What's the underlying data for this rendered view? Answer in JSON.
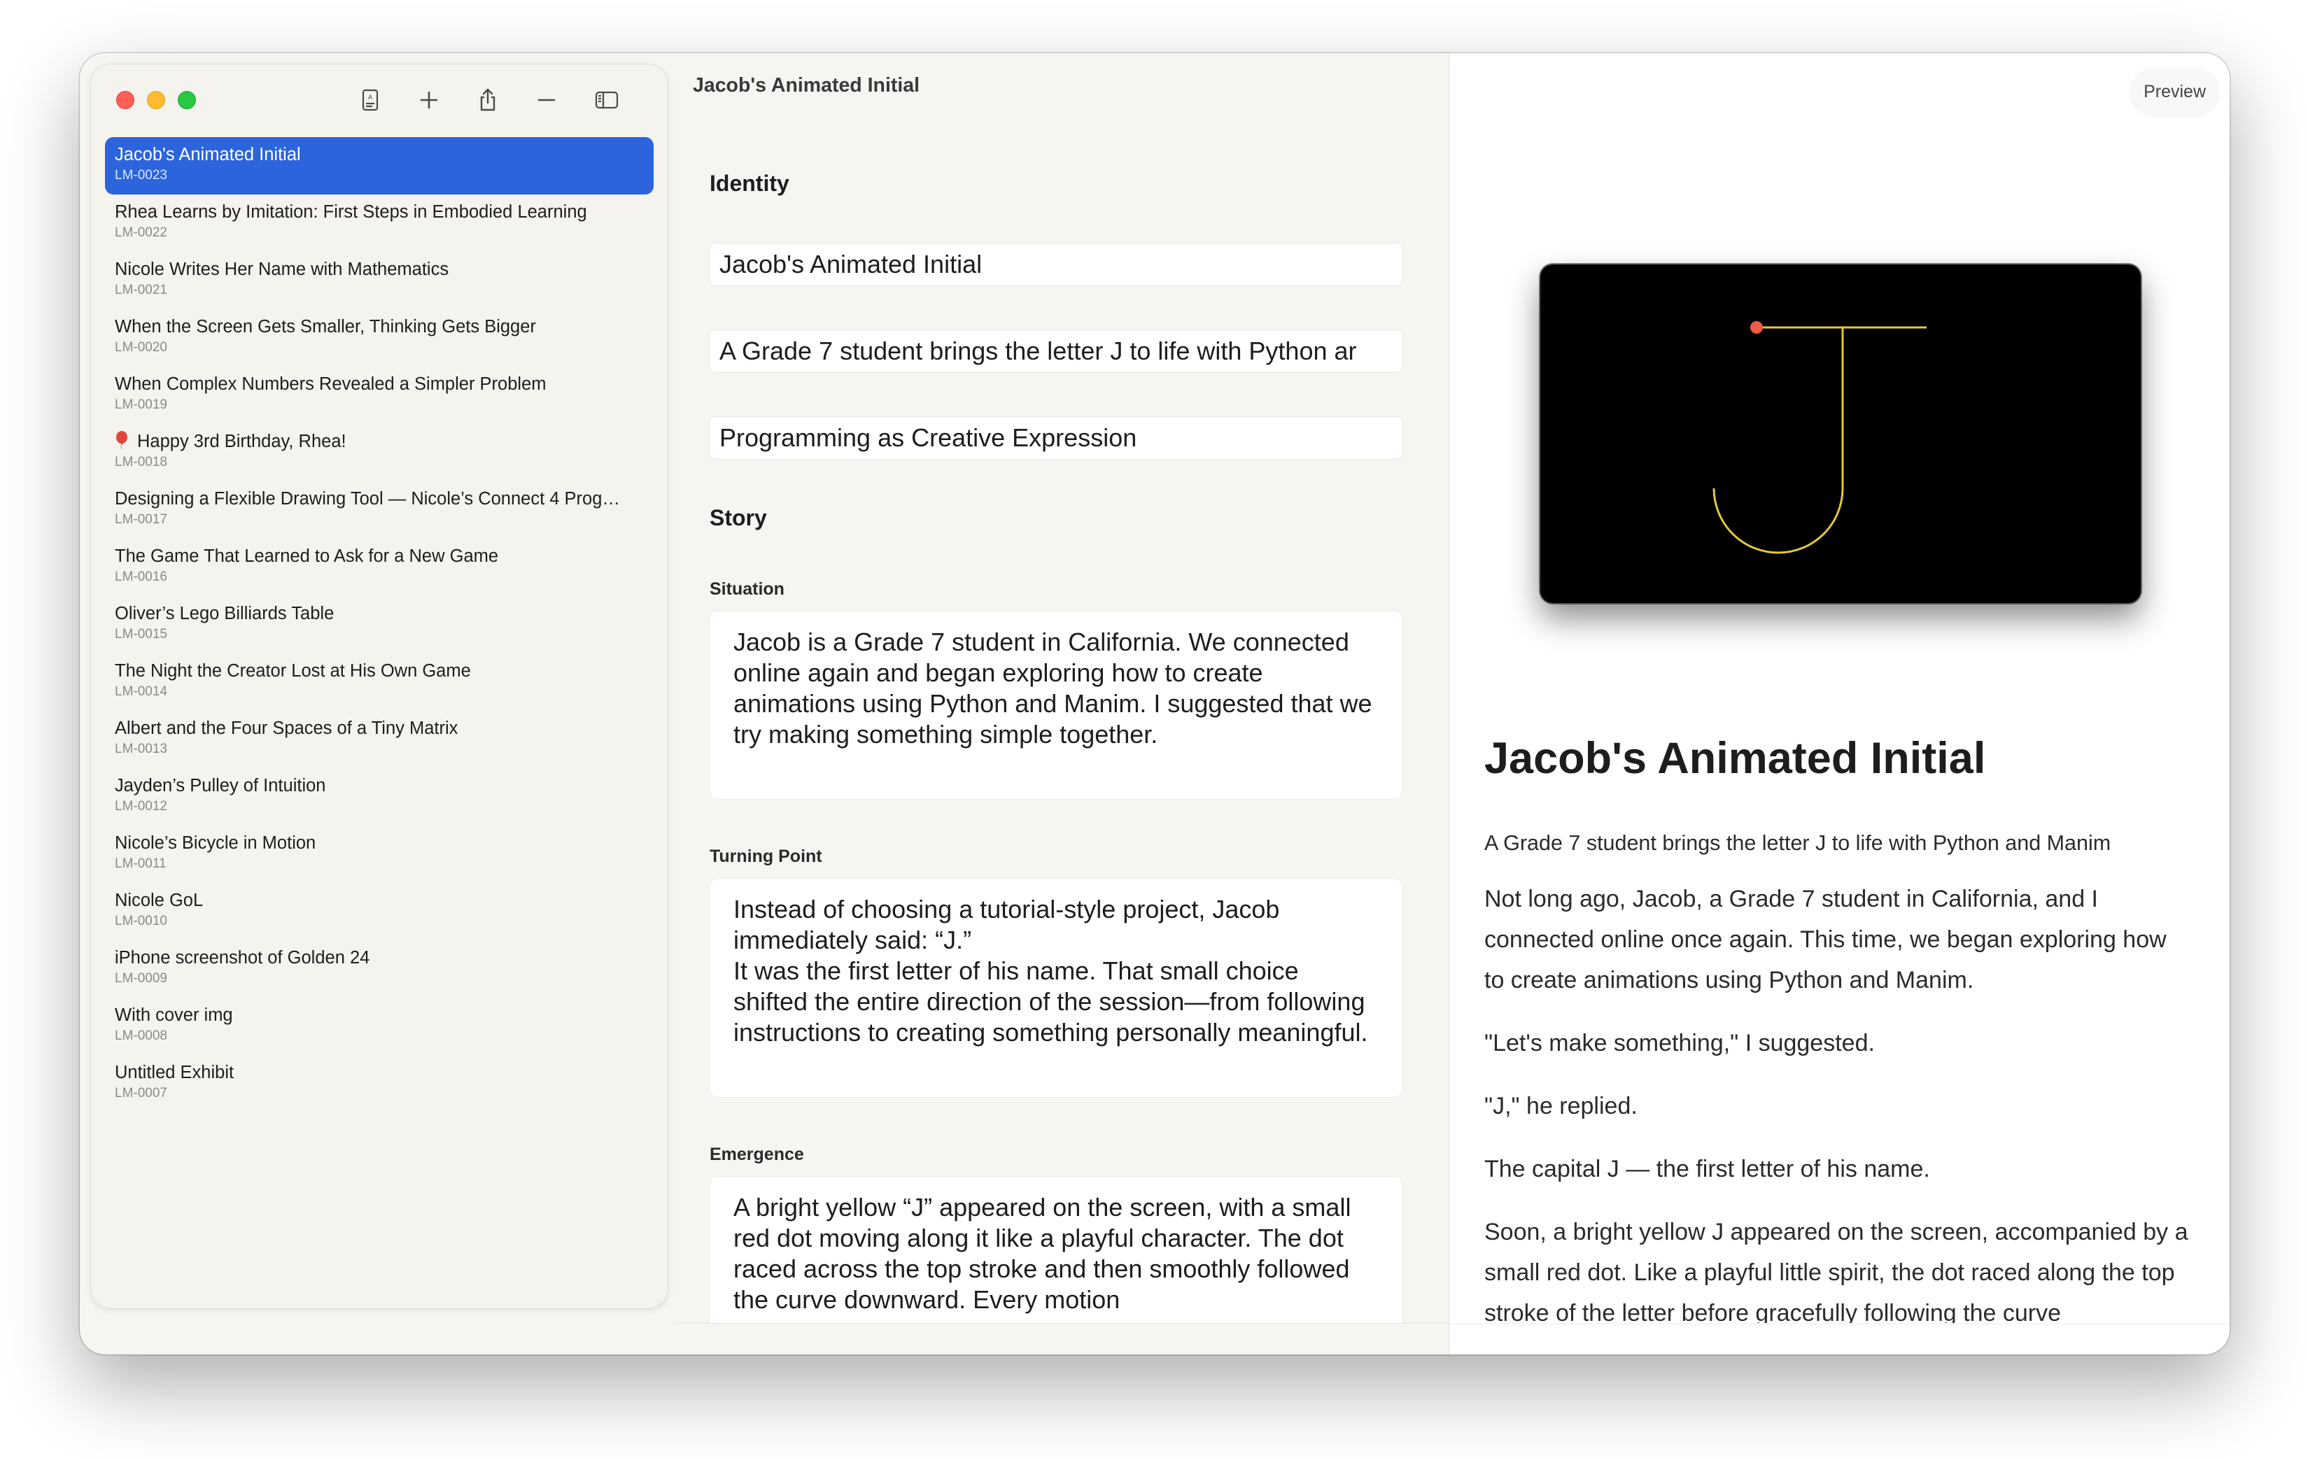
{
  "sidebar": {
    "items": [
      {
        "title": "Jacob's Animated Initial",
        "code": "LM-0023",
        "selected": true
      },
      {
        "title": "Rhea Learns by Imitation: First Steps in Embodied Learning",
        "code": "LM-0022"
      },
      {
        "title": "Nicole Writes Her Name with Mathematics",
        "code": "LM-0021"
      },
      {
        "title": "When the Screen Gets Smaller, Thinking Gets Bigger",
        "code": "LM-0020"
      },
      {
        "title": "When Complex Numbers Revealed a Simpler Problem",
        "code": "LM-0019"
      },
      {
        "title": "Happy 3rd Birthday, Rhea!",
        "code": "LM-0018",
        "icon": "balloon-icon"
      },
      {
        "title": "Designing a Flexible Drawing Tool — Nicole’s Connect 4 Prog…",
        "code": "LM-0017"
      },
      {
        "title": "The Game That Learned to Ask for a New Game",
        "code": "LM-0016"
      },
      {
        "title": "Oliver’s Lego Billiards Table",
        "code": "LM-0015"
      },
      {
        "title": "The Night the Creator Lost at His Own Game",
        "code": "LM-0014"
      },
      {
        "title": "Albert and the Four Spaces of a Tiny Matrix",
        "code": "LM-0013"
      },
      {
        "title": "Jayden’s Pulley of Intuition",
        "code": "LM-0012"
      },
      {
        "title": "Nicole’s Bicycle in Motion",
        "code": "LM-0011"
      },
      {
        "title": "Nicole GoL",
        "code": "LM-0010"
      },
      {
        "title": "iPhone screenshot of Golden 24",
        "code": "LM-0009"
      },
      {
        "title": "With cover img",
        "code": "LM-0008"
      },
      {
        "title": "Untitled Exhibit",
        "code": "LM-0007"
      }
    ],
    "toolbar_icons": [
      "text-format-icon",
      "plus-icon",
      "share-icon",
      "minus-icon",
      "sidebar-toggle-icon"
    ]
  },
  "editor": {
    "title": "Jacob's Animated Initial",
    "identity_heading": "Identity",
    "title_field": "Jacob's Animated Initial",
    "subtitle_field": "A Grade 7 student brings the letter J to life with Python ar",
    "theme_field": "Programming as Creative Expression",
    "story_heading": "Story",
    "situation_label": "Situation",
    "situation_text": "Jacob is a Grade 7 student in California. We connected online again and began exploring how to create animations using Python and Manim. I suggested that we try making something simple together.",
    "turning_point_label": "Turning Point",
    "turning_point_text": "Instead of choosing a tutorial-style project, Jacob immediately said: “J.”\nIt was the first letter of his name. That small choice shifted the entire direction of the session—from following instructions to creating something personally meaningful.",
    "emergence_label": "Emergence",
    "emergence_text": "A bright yellow “J” appeared on the screen, with a small red dot moving along it like a playful character. The dot raced across the top stroke and then smoothly followed the curve downward. Every motion"
  },
  "preview": {
    "button_label": "Preview",
    "title": "Jacob's Animated Initial",
    "subtitle": "A Grade 7 student brings the letter J to life with Python and Manim",
    "paragraphs": [
      "Not long ago, Jacob, a Grade 7 student in California, and I connected online once again. This time, we began exploring how to create animations using Python and Manim.",
      "\"Let's make something,\" I suggested.",
      "\"J,\" he replied.",
      "The capital J — the first letter of his name.",
      "Soon, a bright yellow J appeared on the screen, accompanied by a small red dot. Like a playful little spirit, the dot raced along the top stroke of the letter before gracefully following the curve"
    ]
  },
  "colors": {
    "selection": "#2b64dc",
    "letter_stroke": "#e3c93a",
    "dot": "#ef5a4a"
  }
}
